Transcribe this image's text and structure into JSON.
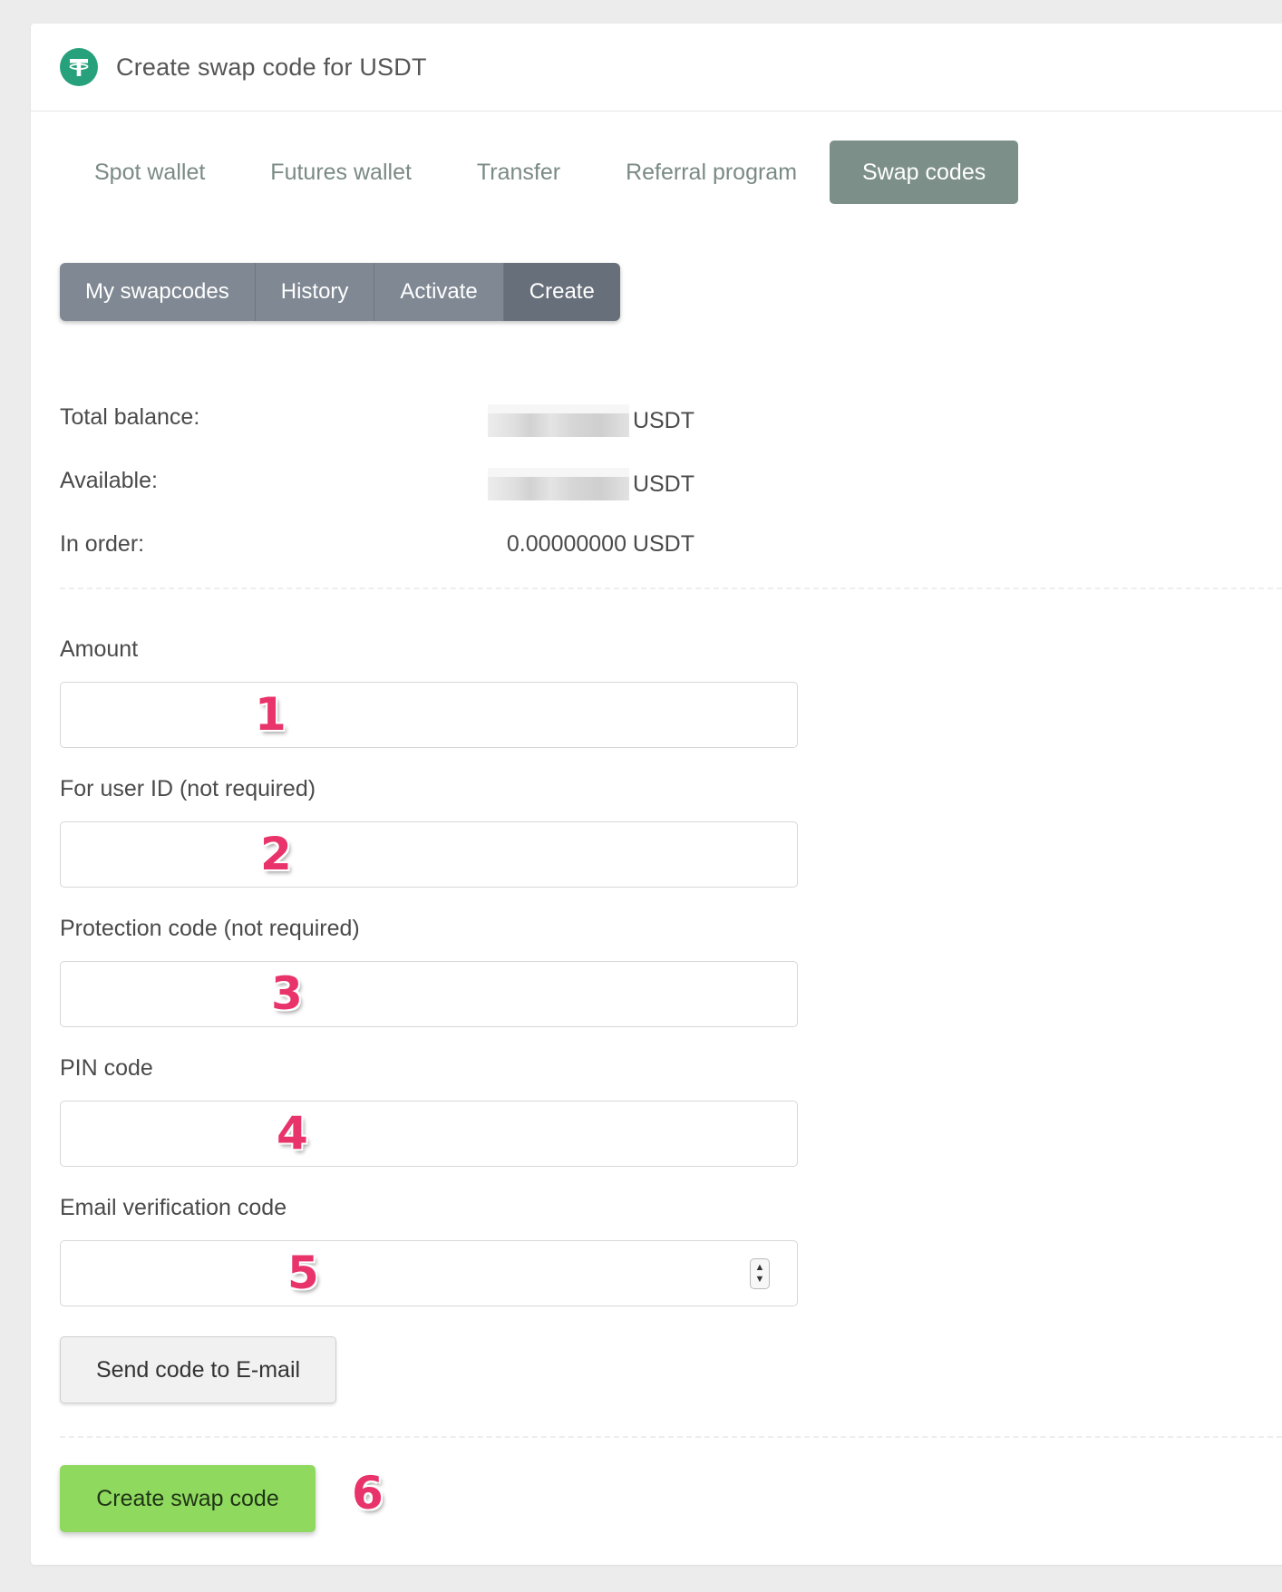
{
  "header": {
    "title": "Create swap code for USDT",
    "logo_icon": "tether-icon",
    "logo_color": "#26a17b"
  },
  "main_tabs": [
    {
      "label": "Spot wallet"
    },
    {
      "label": "Futures wallet"
    },
    {
      "label": "Transfer"
    },
    {
      "label": "Referral program"
    },
    {
      "label": "Swap codes",
      "active": true
    }
  ],
  "sub_tabs": [
    {
      "label": "My swapcodes"
    },
    {
      "label": "History"
    },
    {
      "label": "Activate"
    },
    {
      "label": "Create",
      "active": true
    }
  ],
  "balances": {
    "total": {
      "label": "Total balance:",
      "currency": "USDT"
    },
    "available": {
      "label": "Available:",
      "currency": "USDT"
    },
    "in_order": {
      "label": "In order:",
      "value": "0.00000000 USDT"
    }
  },
  "form": {
    "amount": {
      "label": "Amount",
      "value": "",
      "marker": "1"
    },
    "user_id": {
      "label": "For user ID (not required)",
      "value": "",
      "marker": "2"
    },
    "protection": {
      "label": "Protection code (not required)",
      "value": "",
      "marker": "3"
    },
    "pin": {
      "label": "PIN code",
      "value": "",
      "marker": "4"
    },
    "email_code": {
      "label": "Email verification code",
      "value": "",
      "marker": "5"
    },
    "send_code_label": "Send code to E-mail",
    "create_label": "Create swap code",
    "create_marker": "6"
  },
  "colors": {
    "accent_green": "#8fd95f",
    "tab_active": "#7c8f88",
    "marker": "#e8336b"
  }
}
